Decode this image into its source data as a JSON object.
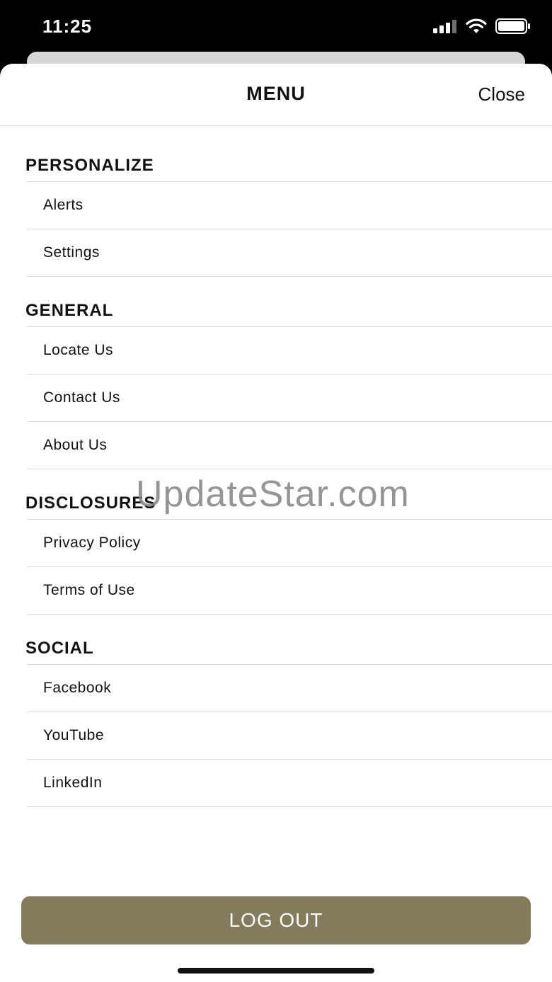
{
  "status_bar": {
    "time": "11:25",
    "icons": [
      "cellular-signal-icon",
      "wifi-icon",
      "battery-icon"
    ]
  },
  "header": {
    "title": "MENU",
    "close_label": "Close"
  },
  "sections": [
    {
      "heading": "PERSONALIZE",
      "items": [
        "Alerts",
        "Settings"
      ]
    },
    {
      "heading": "GENERAL",
      "items": [
        "Locate Us",
        "Contact Us",
        "About Us"
      ]
    },
    {
      "heading": "DISCLOSURES",
      "items": [
        "Privacy Policy",
        "Terms of Use"
      ]
    },
    {
      "heading": "SOCIAL",
      "items": [
        "Facebook",
        "YouTube",
        "LinkedIn"
      ]
    }
  ],
  "watermark": "UpdateStar.com",
  "logout_label": "LOG OUT",
  "colors": {
    "logout_button": "#837b5b",
    "divider": "#dcdcdc"
  }
}
